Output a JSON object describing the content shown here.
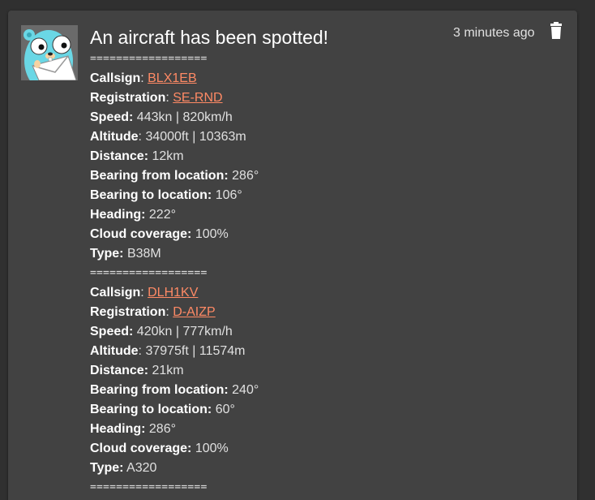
{
  "notification": {
    "title": "An aircraft has been spotted!",
    "timestamp": "3 minutes ago",
    "separator": "==================",
    "labels": {
      "callsign": "Callsign",
      "registration": "Registration",
      "speed": "Speed:",
      "altitude": "Altitude",
      "distance": "Distance:",
      "bearing_from": "Bearing from location:",
      "bearing_to": "Bearing to location:",
      "heading": "Heading:",
      "cloud": "Cloud coverage:",
      "type": "Type:"
    },
    "aircraft": [
      {
        "callsign": "BLX1EB",
        "registration": "SE-RND",
        "speed": "443kn | 820km/h",
        "altitude": "34000ft | 10363m",
        "distance": "12km",
        "bearing_from": "286°",
        "bearing_to": "106°",
        "heading": "222°",
        "cloud": "100%",
        "type": "B38M"
      },
      {
        "callsign": "DLH1KV",
        "registration": "D-AIZP",
        "speed": "420kn | 777km/h",
        "altitude": "37975ft | 11574m",
        "distance": "21km",
        "bearing_from": "240°",
        "bearing_to": "60°",
        "heading": "286°",
        "cloud": "100%",
        "type": "A320"
      }
    ]
  },
  "colors": {
    "background": "#303030",
    "card": "#424242",
    "link": "#ff8a65",
    "text": "#e0e0e0"
  },
  "icons": {
    "avatar": "gopher-avatar",
    "delete": "trash-icon"
  }
}
